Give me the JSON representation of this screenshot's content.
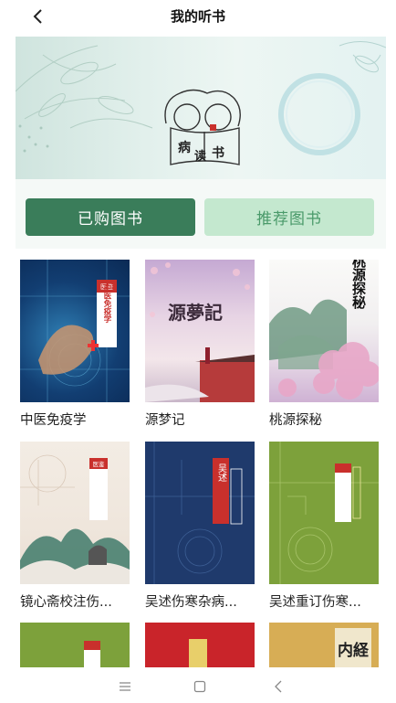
{
  "header": {
    "title": "我的听书",
    "back_icon": "chevron-left-icon"
  },
  "banner": {
    "logo_text_1": "病",
    "logo_text_2": "读",
    "logo_text_3": "书"
  },
  "tabs": [
    {
      "label": "已购图书",
      "active": true
    },
    {
      "label": "推荐图书",
      "active": false
    }
  ],
  "books": [
    {
      "title": "中医免疫学",
      "cover_text": "中医免疫学",
      "series": "医鉴"
    },
    {
      "title": "源梦记",
      "cover_text": "源夢記"
    },
    {
      "title": "桃源探秘",
      "cover_text": "桃源探秘"
    },
    {
      "title": "镜心斋校注伤...",
      "series": "医鉴"
    },
    {
      "title": "吴述伤寒杂病...",
      "cover_text": "吴述"
    },
    {
      "title": "吴述重订伤寒..."
    },
    {
      "title": ""
    },
    {
      "title": ""
    },
    {
      "title": "",
      "cover_text": "内経"
    }
  ],
  "colors": {
    "accent": "#3a7d5a",
    "tab_inactive_bg": "#c4e8cf",
    "tab_inactive_text": "#4a9a6a"
  },
  "system_nav": {
    "menu_icon": "menu-icon",
    "home_icon": "square-icon",
    "back_icon": "triangle-back-icon"
  }
}
